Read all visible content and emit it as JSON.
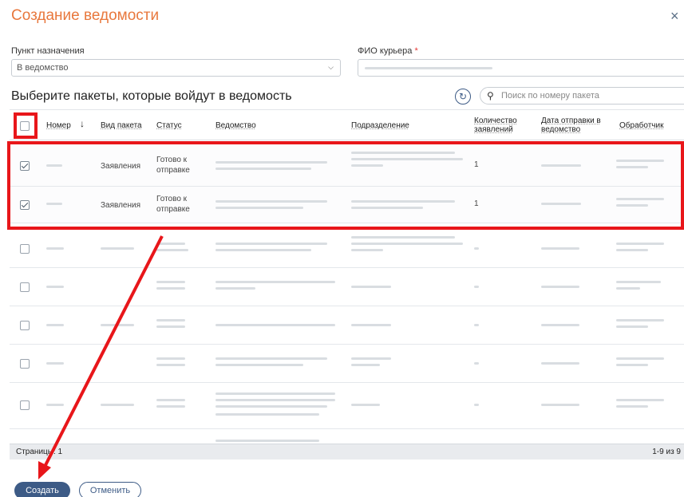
{
  "dialog": {
    "title": "Создание ведомости",
    "close_glyph": "×"
  },
  "destination": {
    "label": "Пункт назначения",
    "value": "В ведомство"
  },
  "courier": {
    "label": "ФИО курьера",
    "required_mark": "*"
  },
  "packages": {
    "heading": "Выберите пакеты, которые войдут в ведомость",
    "search_placeholder": "Поиск по номеру пакета"
  },
  "table": {
    "columns": {
      "number": "Номер",
      "sort_glyph": "↓",
      "type": "Вид пакета",
      "status": "Статус",
      "agency": "Ведомство",
      "department": "Подразделение",
      "count": "Количество заявлений",
      "sent_date": "Дата отправки в ведомство",
      "handler": "Обработчик"
    },
    "rows": [
      {
        "checked": true,
        "type": "Заявления",
        "status": "Готово к отправке",
        "count": "1"
      },
      {
        "checked": true,
        "type": "Заявления",
        "status": "Готово к отправке",
        "count": "1"
      },
      {
        "checked": false
      },
      {
        "checked": false
      },
      {
        "checked": false
      },
      {
        "checked": false
      },
      {
        "checked": false
      }
    ]
  },
  "footer": {
    "pages_label": "Страницы: 1",
    "range": "1-9 из 9"
  },
  "actions": {
    "create": "Создать",
    "cancel": "Отменить"
  },
  "colors": {
    "title": "#e8783d",
    "primary": "#3d5b86",
    "annotation": "#e8161a"
  },
  "icons": {
    "refresh": "refresh-icon",
    "search": "search-icon",
    "close": "close-icon",
    "dropdown": "chevron-down-icon"
  }
}
